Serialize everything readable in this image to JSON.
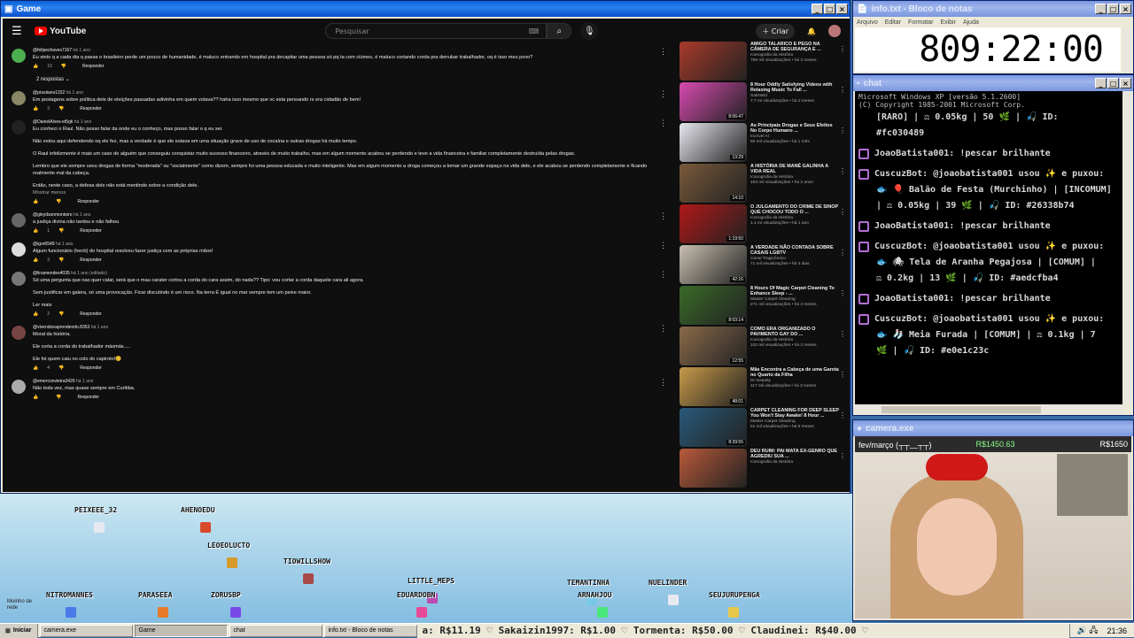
{
  "windows": {
    "game": {
      "title": "Game"
    },
    "notepad": {
      "title": "info.txt - Bloco de notas",
      "menu": [
        "Arquivo",
        "Editar",
        "Formatar",
        "Exibir",
        "Ajuda"
      ],
      "text": "809:22:00"
    },
    "chat": {
      "title": "chat"
    },
    "camera": {
      "title": "camera.exe"
    }
  },
  "youtube": {
    "logo": "YouTube",
    "search_placeholder": "Pesquisar",
    "create_label": "Criar",
    "comments": [
      {
        "author": "@felipechaves7167",
        "time": "há 1 ano",
        "text": "Eu sinto q a cada dia q passa o brasileiro perde um pouco de humanidade, é maluco entrando em hospital pra decapitar uma pessoa só pq ta com ciúmes, é maluco cortando corda pra derrubar trabalhador, oq é isso meu povo?",
        "likes": "10",
        "avatar": "#4caf50"
      },
      {
        "author": "@prusiiano1152",
        "time": "há 1 ano",
        "text": "Em postagens sobre política dele de eleições passadas adivinha em quem votava?? haha isso mesmo que vc esta pensando rs era cidadão de bem!",
        "likes": "3",
        "avatar": "#886"
      },
      {
        "author": "@DanielAlves-et5gk",
        "time": "há 1 ano",
        "paras": [
          "Eu conheci o Raul. Não posso falar da onde eu o conheço, mas posso falar o q eu sei.",
          "Não estou aqui defendendo oq ele fez, mas a verdade é que ele estava em uma situação grave de uso de cocaína e outras drogas há muito tempo.",
          "O Raul infelizmente é mais um caso de alguém que conseguiu conquistar muito sucesso financeiro, através de muito trabalho, mas em algum momento acabou se perdendo e teve a vida financeira e familiar completamente destruída pelas drogas.",
          "Lembro que ele sempre usou drogas de forma \"moderada\" ou \"socialmente\" como dizem, sempre foi uma pessoa educada e muito inteligente. Mas em algum momento a droga começou a tomar um grande espaço na vida dele, e ele acabou se perdendo completamente e ficando realmente mal da cabeça.",
          "Então, neste caso, a defesa dele não está mentindo sobre a condição dele."
        ],
        "show_less": "Mostrar menos",
        "likes": "",
        "avatar": "#222"
      },
      {
        "author": "@gleydsonmonteiro",
        "time": "há 1 ano",
        "text": "a justiça divina não tardou e não falhou",
        "likes": "1",
        "avatar": "#666"
      },
      {
        "author": "@igor6549",
        "time": "há 1 ano",
        "text": "Algum funcionário (herói) do hospital resolveu fazer justiça com as próprias mãos!",
        "likes": "3",
        "avatar": "#ddd"
      },
      {
        "author": "@linamendes4035",
        "time": "há 1 ano (editado)",
        "paras": [
          "Só uma pergunta que nao quer calar, será que o mau carater cortou a corda do cara assim, do nada??  Tipo: vou cortar a corda daquele cara ali agora.",
          "Sem justificar em galera, só uma provocação. Ficar discutindo é um risco.  Na terra É igual no mar sempre tem um peixe maior."
        ],
        "read_more": "Ler mais",
        "likes": "2",
        "avatar": "#777"
      },
      {
        "author": "@vivendoeaprendendo.8353",
        "time": "há 1 ano",
        "paras": [
          "Moral da história.",
          "Ele corta a corda do trabalhador másmás.....",
          "Ele foi quem caiu no colo do capiroto!😊"
        ],
        "likes": "4",
        "avatar": "#744"
      },
      {
        "author": "@emerconvieira3426",
        "time": "há 1 ano",
        "text": "Não toda vez, mas quase sempre em Curitiba.",
        "likes": "",
        "avatar": "#aaa"
      }
    ],
    "replies_label": "2 respostas",
    "reply_label": "Responder",
    "sidebar": [
      {
        "title": "AMIGO TALARICO É PEGO NA CÂMERA DE SEGURANÇA E ...",
        "channel": "Iconografia da História",
        "meta": "768 mil visualizações • há 2 meses",
        "dur": "",
        "color": "#a83a2a"
      },
      {
        "title": "8 Hour Oddly Satisfying Videos with Relaxing Music To Fall ...",
        "channel": "SatisWid",
        "meta": "7,7 mi visualizações • há 2 meses",
        "dur": "8:06:47",
        "color": "#d84ab0"
      },
      {
        "title": "As Principais Drogas e Seus Efeitos No Corpo Humano ...",
        "channel": "Incrível AI",
        "meta": "60 mil visualizações • há 1 mês",
        "dur": "13:29",
        "color": "#e8e8f0"
      },
      {
        "title": "A HISTÓRIA DE MANÉ GALINHA A VIDA REAL",
        "channel": "Iconografia da História",
        "meta": "193 mil visualizações • há 2 anos",
        "dur": "14:10",
        "color": "#7a5a3a"
      },
      {
        "title": "O JULGAMENTO DO CRIME DE SINOP QUE CHOCOU TODO O ...",
        "channel": "Iconografia da História",
        "meta": "1,1 mi visualizações • há 1 ano",
        "dur": "1:19:50",
        "color": "#b01818"
      },
      {
        "title": "A VERDADE NÃO CONTADA SOBRE CASAIS LGBTV",
        "channel": "Canal Tragicômico",
        "meta": "71 mil visualizações • há 4 dias",
        "dur": "42:16",
        "color": "#c8c0b0"
      },
      {
        "title": "8 Hours Of Magic Carpet Cleaning To Enhance Sleep - ...",
        "channel": "Master Carpet Cleaning",
        "meta": "271 mil visualizações • há 2 meses",
        "dur": "8:03:14",
        "color": "#3a6a2a"
      },
      {
        "title": "COMO ERA ORGANIZADO O PAVIMENTO GAY DO ...",
        "channel": "Iconografia da História",
        "meta": "102 mil visualizações • há 2 meses",
        "dur": "12:55",
        "color": "#8a6a4a"
      },
      {
        "title": "Mãe Encontra a Cabeça de uma Garota no Quarto da Filha",
        "channel": "Dr Insanity",
        "meta": "117 mil visualizações • há 3 meses",
        "dur": "48:01",
        "color": "#c89a4a"
      },
      {
        "title": "CARPET CLEANING FOR DEEP SLEEP You Won't Stay Awake! 8 Hour ...",
        "channel": "Master Carpet Cleaning",
        "meta": "51 mil visualizações • há 9 meses",
        "dur": "8:39:55",
        "color": "#2a5a7a"
      },
      {
        "title": "DEU RUIM: PAI MATA EX-GENRO QUE AGREDIU SUA ...",
        "channel": "Iconografia da História",
        "meta": "",
        "dur": "",
        "color": "#b85a3a"
      }
    ]
  },
  "chat": {
    "header": [
      "Microsoft Windows XP [versão 5.1.2600]",
      "(C) Copyright 1985-2001 Microsoft Corp."
    ],
    "lines": [
      {
        "indent": true,
        "text": "[RARO] | ⚖ 0.05kg | 50 🌿 | 🎣 ID:"
      },
      {
        "indent": true,
        "text": "#fc030489"
      },
      {
        "indent": false,
        "text": "JoaoBatista001: !pescar brilhante"
      },
      {
        "indent": false,
        "text": "CuscuzBot: @joaobatista001 usou ✨ e puxou:"
      },
      {
        "indent": true,
        "text": "🐟 🎈 Balão de Festa (Murchinho) | [INCOMUM]"
      },
      {
        "indent": true,
        "text": "| ⚖ 0.05kg | 39 🌿 | 🎣 ID: #26338b74"
      },
      {
        "indent": false,
        "text": "JoaoBatista001: !pescar brilhante"
      },
      {
        "indent": false,
        "text": "CuscuzBot: @joaobatista001 usou ✨ e puxou:"
      },
      {
        "indent": true,
        "text": "🐟 🕷 Tela de Aranha Pegajosa | [COMUM] |"
      },
      {
        "indent": true,
        "text": "⚖ 0.2kg | 13 🌿 | 🎣 ID: #aedcfba4"
      },
      {
        "indent": false,
        "text": "JoaoBatista001: !pescar brilhante"
      },
      {
        "indent": false,
        "text": "CuscuzBot: @joaobatista001 usou ✨ e puxou:"
      },
      {
        "indent": true,
        "text": "🐟 🧦 Meia Furada | [COMUM] | ⚖ 0.1kg | 7"
      },
      {
        "indent": true,
        "text": "🌿 | 🎣 ID: #e0e1c23c"
      }
    ]
  },
  "camera": {
    "goal_label": "fev/março (┬┬﹏┬┬)",
    "current": "R$1450.63",
    "target": "R$1650"
  },
  "field": {
    "players": [
      "PEIXEEE_32",
      "AHENOEDU",
      "LEOEOLUCTO",
      "TIOWILLSHOW",
      "LITTLE_MEPS",
      "TEMANTINHA",
      "NUELINDER",
      "NITROMANNES",
      "PARASEEA",
      "ZORUSBP",
      "EDUARDOBN",
      "ARNAHJOU",
      "SEUJURUPENGA"
    ],
    "corner_label": "Moinho de rede"
  },
  "taskbar": {
    "start": "Iniciar",
    "tasks": [
      "camera.exe",
      "Game",
      "chat",
      "info.txt - Bloco de notas"
    ],
    "ticker": "a: R$11.19  ♡ Sakaizin1997: R$1.00  ♡ Tormenta: R$50.00  ♡ Claudinei: R$40.00  ♡",
    "clock": "21:36"
  }
}
